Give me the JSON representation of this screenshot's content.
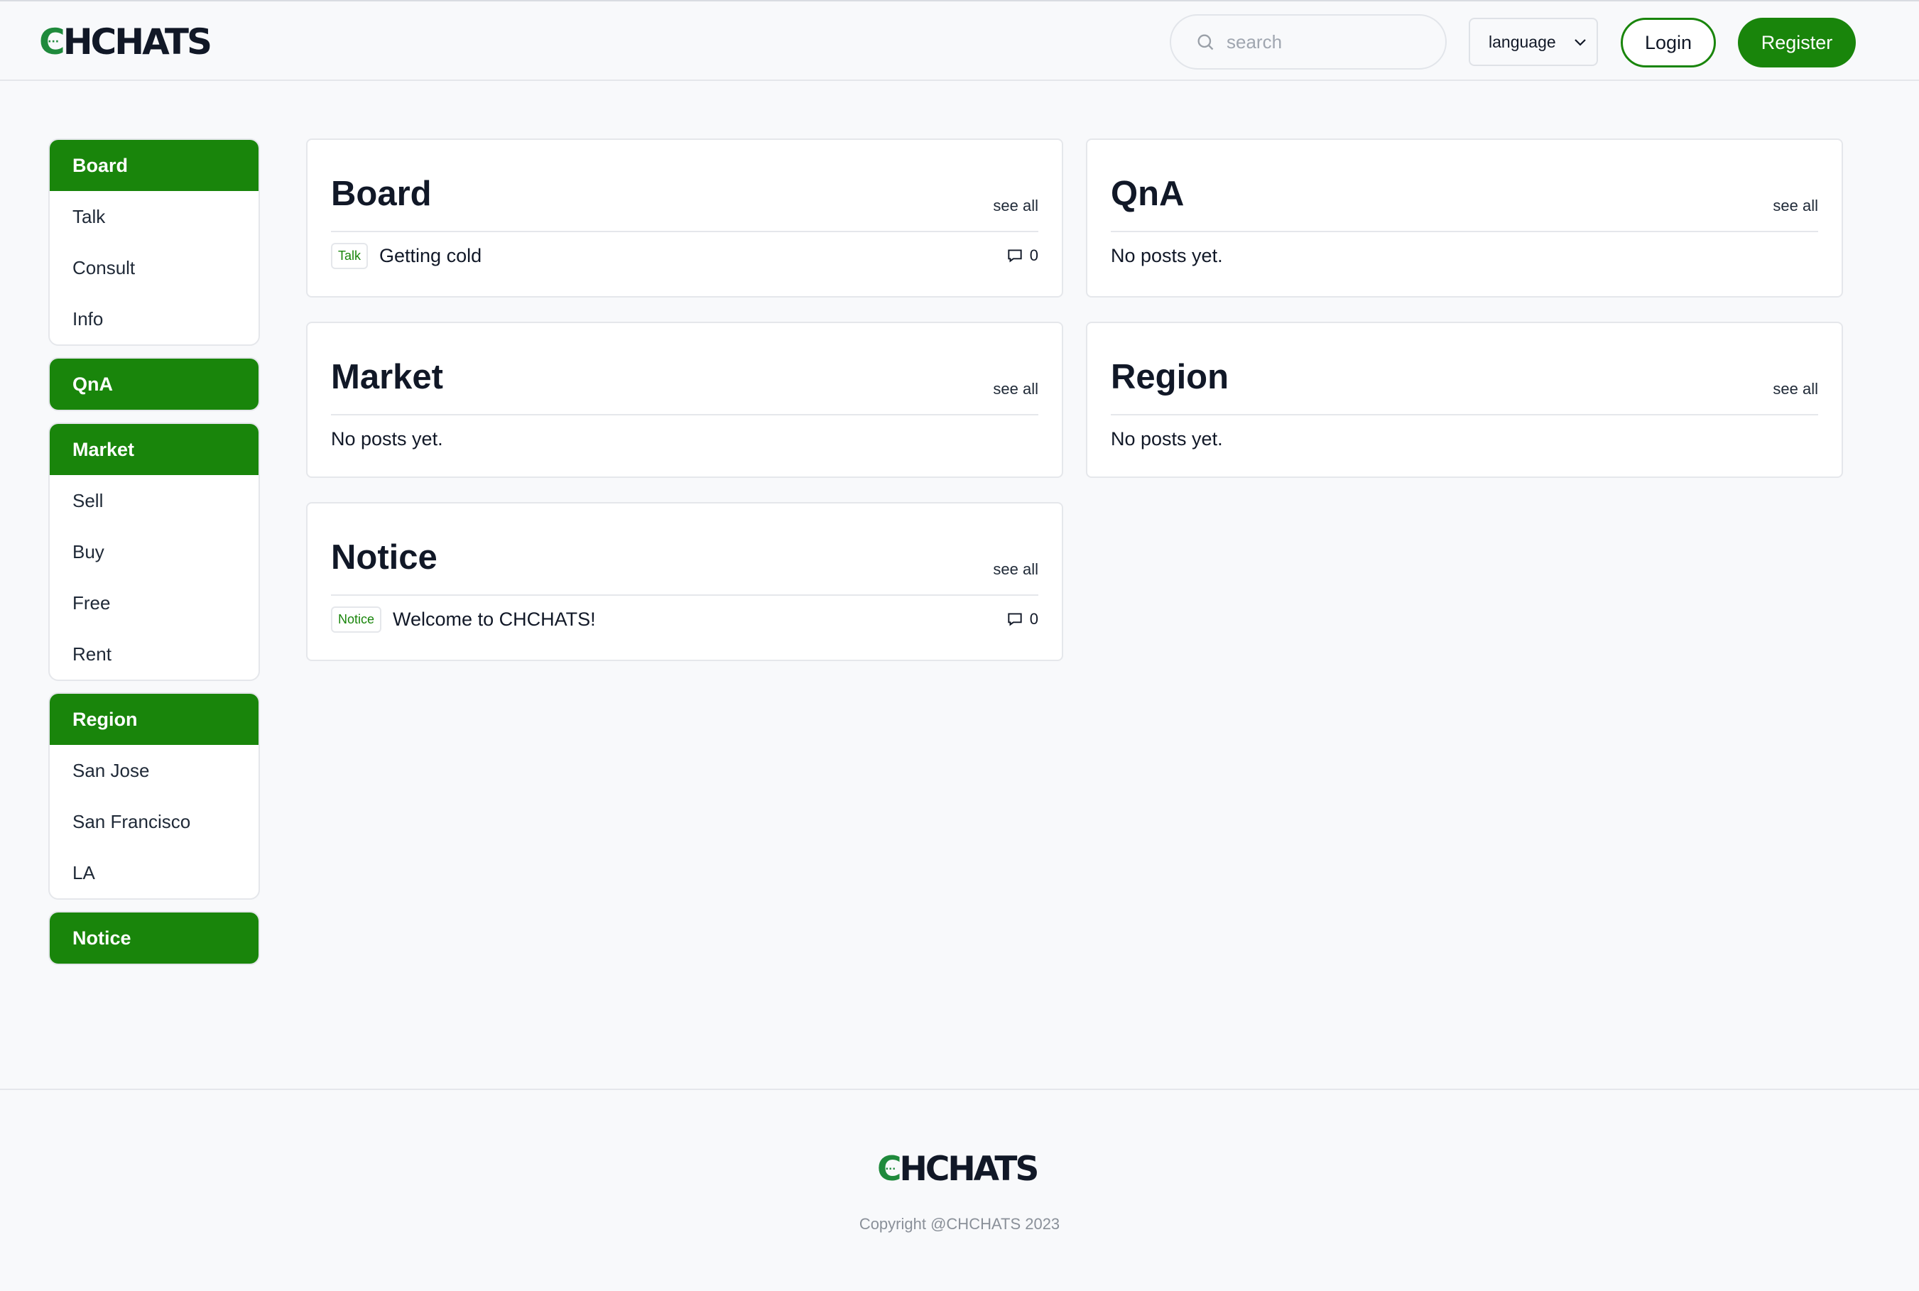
{
  "header": {
    "logo_c": "C",
    "logo_rest": "HCHATS",
    "logo_dots": "···",
    "search_placeholder": "search",
    "language_label": "language",
    "login_label": "Login",
    "register_label": "Register"
  },
  "sidebar": [
    {
      "head": "Board",
      "items": [
        "Talk",
        "Consult",
        "Info"
      ]
    },
    {
      "head": "QnA",
      "items": []
    },
    {
      "head": "Market",
      "items": [
        "Sell",
        "Buy",
        "Free",
        "Rent"
      ]
    },
    {
      "head": "Region",
      "items": [
        "San Jose",
        "San Francisco",
        "LA"
      ]
    },
    {
      "head": "Notice",
      "items": []
    }
  ],
  "cards": {
    "board": {
      "title": "Board",
      "see_all": "see all",
      "post": {
        "tag": "Talk",
        "title": "Getting cold",
        "comments": "0"
      }
    },
    "qna": {
      "title": "QnA",
      "see_all": "see all",
      "empty": "No posts yet."
    },
    "market": {
      "title": "Market",
      "see_all": "see all",
      "empty": "No posts yet."
    },
    "region": {
      "title": "Region",
      "see_all": "see all",
      "empty": "No posts yet."
    },
    "notice": {
      "title": "Notice",
      "see_all": "see all",
      "post": {
        "tag": "Notice",
        "title": "Welcome to CHCHATS!",
        "comments": "0"
      }
    }
  },
  "footer": {
    "copyright": "Copyright @CHCHATS 2023"
  },
  "colors": {
    "brand_green": "#19850b",
    "logo_green": "#1f8a3c",
    "background": "#f8f9fb"
  },
  "icons": [
    "search-icon",
    "chevron-down-icon",
    "comment-icon"
  ]
}
